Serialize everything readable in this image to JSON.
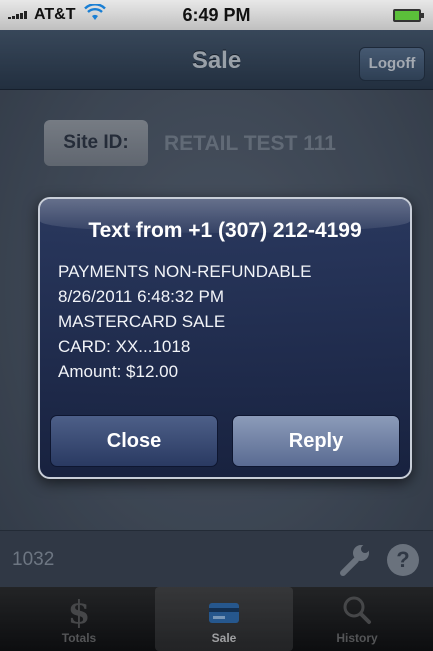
{
  "status_bar": {
    "carrier": "AT&T",
    "time": "6:49 PM"
  },
  "nav": {
    "title": "Sale",
    "logoff_label": "Logoff"
  },
  "content": {
    "site_id_label": "Site ID:",
    "site_id_value": "RETAIL TEST 111",
    "footer_code": "1032"
  },
  "alert": {
    "title": "Text from +1 (307) 212-4199",
    "lines": [
      "PAYMENTS NON-REFUNDABLE",
      "8/26/2011 6:48:32 PM",
      "MASTERCARD SALE",
      "CARD: XX...1018",
      "Amount: $12.00"
    ],
    "close_label": "Close",
    "reply_label": "Reply"
  },
  "tabs": [
    {
      "label": "Totals",
      "icon": "dollar-icon"
    },
    {
      "label": "Sale",
      "icon": "card-icon",
      "active": true
    },
    {
      "label": "History",
      "icon": "search-icon"
    }
  ],
  "colors": {
    "nav": "#34465b",
    "alert_bg": "#1e2c55",
    "battery": "#5bbf3a"
  }
}
